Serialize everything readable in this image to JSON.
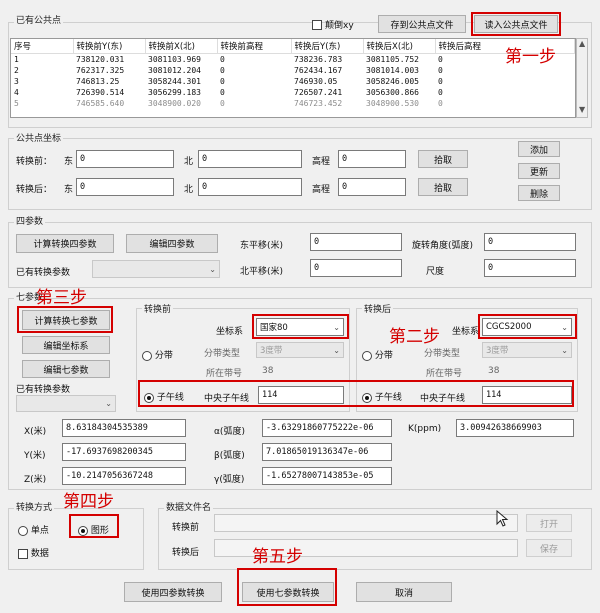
{
  "common_points": {
    "group_title": "已有公共点",
    "flip_label": "颠倒xy",
    "save_button": "存到公共点文件",
    "load_button": "读入公共点文件",
    "columns": [
      "序号",
      "转换前Y(东)",
      "转换前X(北)",
      "转换前高程",
      "转换后Y(东)",
      "转换后X(北)",
      "转换后高程"
    ],
    "rows": [
      [
        "1",
        "738120.031",
        "3081103.969",
        "0",
        "738236.783",
        "3081105.752",
        "0"
      ],
      [
        "2",
        "762317.325",
        "3081012.204",
        "0",
        "762434.167",
        "3081014.003",
        "0"
      ],
      [
        "3",
        "746813.25",
        "3058244.301",
        "0",
        "746930.05",
        "3058246.005",
        "0"
      ],
      [
        "4",
        "726390.514",
        "3056299.183",
        "0",
        "726507.241",
        "3056300.866",
        "0"
      ],
      [
        "5",
        "746585.640",
        "3048900.020",
        "0",
        "746723.452",
        "3048900.530",
        "0"
      ]
    ]
  },
  "point_coords": {
    "group_title": "公共点坐标",
    "before_label": "转换前：",
    "after_label": "转换后：",
    "east_label": "东",
    "north_label": "北",
    "height_label": "高程",
    "before_east": "0",
    "before_north": "0",
    "before_height": "0",
    "after_east": "0",
    "after_north": "0",
    "after_height": "0",
    "pick_label": "拾取",
    "add_label": "添加",
    "update_label": "更新",
    "delete_label": "删除"
  },
  "four_params": {
    "group_title": "四参数",
    "calc_button": "计算转换四参数",
    "edit_button": "编辑四参数",
    "existing_label": "已有转换参数",
    "east_shift_label": "东平移(米)",
    "east_shift_value": "0",
    "north_shift_label": "北平移(米)",
    "north_shift_value": "0",
    "rotation_label": "旋转角度(弧度)",
    "rotation_value": "0",
    "scale_label": "尺度",
    "scale_value": "0"
  },
  "seven_params": {
    "group_title": "七参数",
    "calc_button": "计算转换七参数",
    "edit_coord_button": "编辑坐标系",
    "edit_seven_button": "编辑七参数",
    "existing_label": "已有转换参数",
    "before_title": "转换前",
    "after_title": "转换后",
    "coord_sys_label": "坐标系",
    "before_coord_sys": "国家80",
    "after_coord_sys": "CGCS2000",
    "zone_label": "分带",
    "zone_type_label": "分带类型",
    "zone_type_value": "3度带",
    "zone_no_label": "所在带号",
    "zone_no_value": "38",
    "meridian_label": "子午线",
    "central_meridian_label": "中央子午线",
    "before_meridian": "114",
    "after_meridian": "114",
    "x_label": "X(米)",
    "y_label": "Y(米)",
    "z_label": "Z(米)",
    "x_value": "8.63184304535389",
    "y_value": "-17.6937698200345",
    "z_value": "-10.2147056367248",
    "ax_label": "α(弧度)",
    "by_label": "β(弧度)",
    "gz_label": "γ(弧度)",
    "ax_value": "-3.63291860775222e-06",
    "by_value": "7.01865019136347e-06",
    "gz_value": "-1.65278007143853e-05",
    "k_label": "K(ppm)",
    "k_value": "3.00942638669903"
  },
  "conversion_mode": {
    "group_title": "转换方式",
    "single_label": "单点",
    "graphic_label": "图形",
    "data_label": "数据"
  },
  "data_file": {
    "group_title": "数据文件名",
    "before_label": "转换前",
    "after_label": "转换后",
    "open_label": "打开",
    "save_label": "保存"
  },
  "bottom": {
    "use_four_button": "使用四参数转换",
    "use_seven_button": "使用七参数转换",
    "cancel_button": "取消"
  },
  "annotations": {
    "step1": "第一步",
    "step2": "第二步",
    "step3": "第三步",
    "step4": "第四步",
    "step5": "第五步",
    "color": "#d40000"
  }
}
